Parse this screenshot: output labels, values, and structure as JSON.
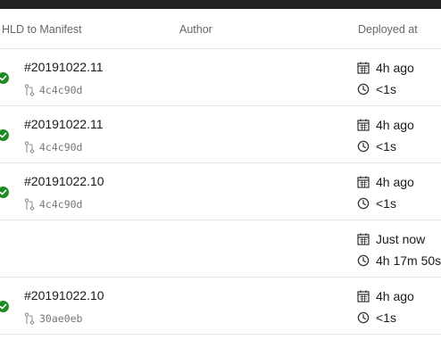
{
  "header": {
    "hld_label": "HLD to Manifest",
    "author_label": "Author",
    "deployed_label": "Deployed at"
  },
  "rows": [
    {
      "status": "success",
      "build": "#20191022.11",
      "commit": "4c4c90d",
      "deployed": "4h ago",
      "duration": "<1s"
    },
    {
      "status": "success",
      "build": "#20191022.11",
      "commit": "4c4c90d",
      "deployed": "4h ago",
      "duration": "<1s"
    },
    {
      "status": "success",
      "build": "#20191022.10",
      "commit": "4c4c90d",
      "deployed": "4h ago",
      "duration": "<1s"
    },
    {
      "status": "",
      "build": "",
      "commit": "",
      "deployed": "Just now",
      "duration": "4h 17m 50s"
    },
    {
      "status": "success",
      "build": "#20191022.10",
      "commit": "30ae0eb",
      "deployed": "4h ago",
      "duration": "<1s"
    }
  ],
  "icons": {
    "status": "check-circle-icon",
    "commit": "git-branch-icon",
    "deployed": "calendar-icon",
    "duration": "clock-icon"
  },
  "colors": {
    "success": "#1f8a1f",
    "header_text": "#666666",
    "divider": "#e8e8e8",
    "topbar": "#222222"
  }
}
